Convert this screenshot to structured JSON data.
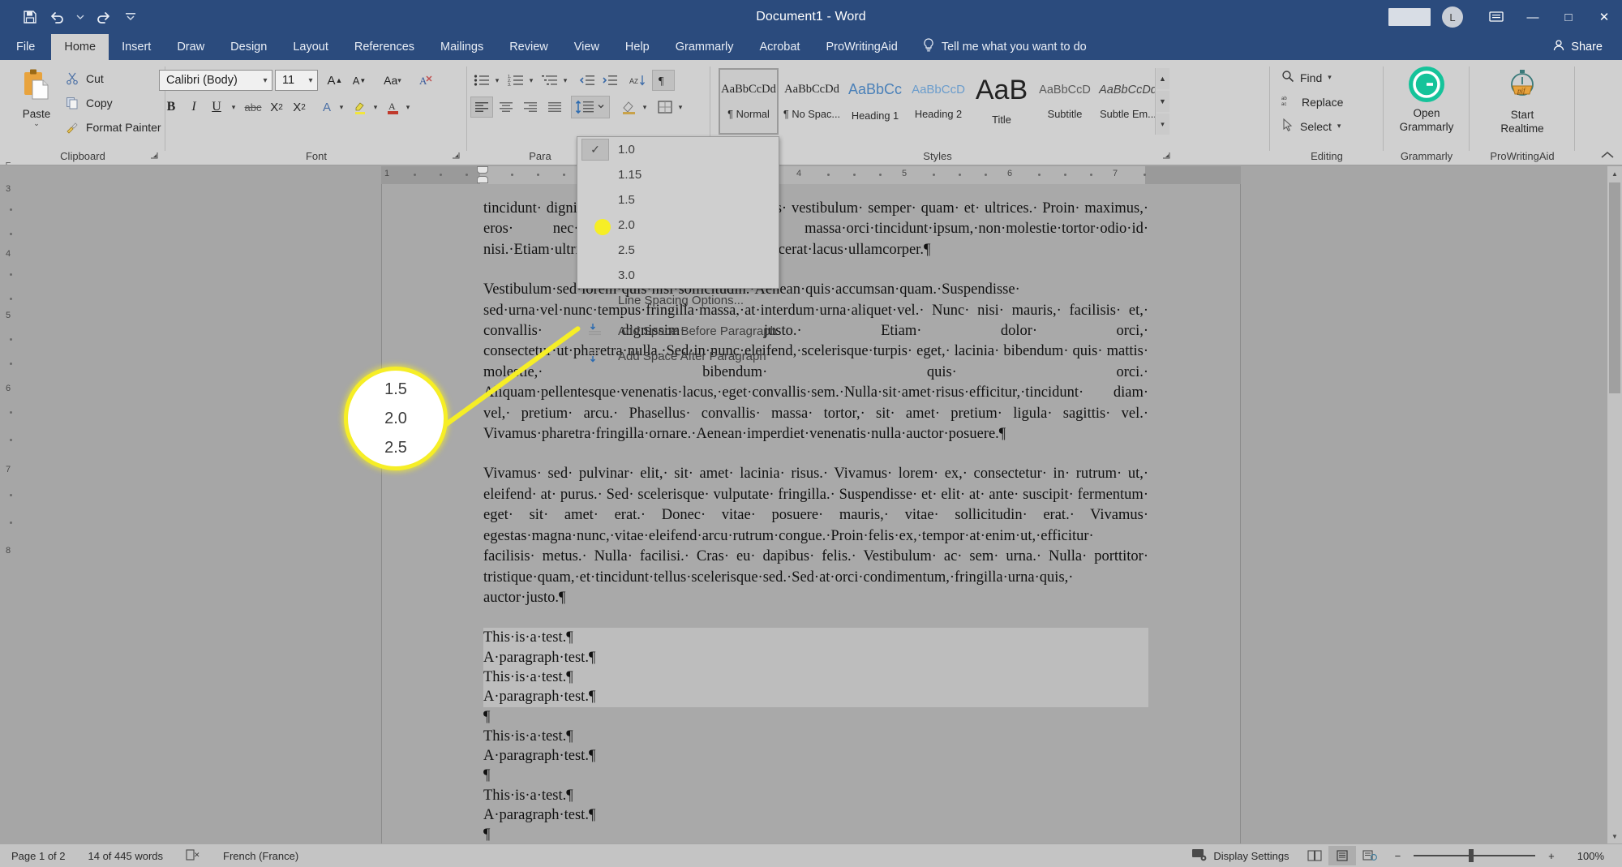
{
  "titlebar": {
    "document_title": "Document1  -  Word",
    "qat": [
      {
        "name": "save-button",
        "icon": "save-icon"
      },
      {
        "name": "undo-button",
        "icon": "undo-icon"
      },
      {
        "name": "undo-dropdown",
        "icon": "chevron-down-icon"
      },
      {
        "name": "redo-button",
        "icon": "redo-icon"
      },
      {
        "name": "customize-qat-button",
        "icon": "chevron-down-bar-icon"
      }
    ],
    "avatar_initial": "L",
    "window_controls": {
      "minimize": "—",
      "restore": "□",
      "close": "✕"
    }
  },
  "tabs": [
    {
      "label": "File",
      "active": false
    },
    {
      "label": "Home",
      "active": true
    },
    {
      "label": "Insert",
      "active": false
    },
    {
      "label": "Draw",
      "active": false
    },
    {
      "label": "Design",
      "active": false
    },
    {
      "label": "Layout",
      "active": false
    },
    {
      "label": "References",
      "active": false
    },
    {
      "label": "Mailings",
      "active": false
    },
    {
      "label": "Review",
      "active": false
    },
    {
      "label": "View",
      "active": false
    },
    {
      "label": "Help",
      "active": false
    },
    {
      "label": "Grammarly",
      "active": false
    },
    {
      "label": "Acrobat",
      "active": false
    },
    {
      "label": "ProWritingAid",
      "active": false
    }
  ],
  "tellme": {
    "label": "Tell me what you want to do"
  },
  "share": {
    "label": "Share"
  },
  "ribbon": {
    "clipboard": {
      "group_label": "Clipboard",
      "paste_label": "Paste",
      "items": [
        {
          "label": "Cut",
          "icon": "scissors-icon"
        },
        {
          "label": "Copy",
          "icon": "copy-icon"
        },
        {
          "label": "Format Painter",
          "icon": "format-painter-icon"
        }
      ]
    },
    "font": {
      "group_label": "Font",
      "font_name": "Calibri (Body)",
      "font_size": "11",
      "buttons": [
        "grow-font",
        "shrink-font",
        "change-case",
        "clear-formatting",
        "bold",
        "italic",
        "underline",
        "underline-dropdown",
        "strikethrough",
        "subscript",
        "superscript",
        "text-effects",
        "text-highlight",
        "font-color"
      ]
    },
    "paragraph": {
      "group_label": "Para",
      "buttons": [
        "bullets",
        "numbering",
        "multilevel-list",
        "decrease-indent",
        "increase-indent",
        "sort",
        "show-formatting-marks",
        "align-left",
        "align-center",
        "align-right",
        "justify",
        "line-spacing",
        "shading",
        "borders"
      ]
    },
    "styles": {
      "group_label": "Styles",
      "items": [
        {
          "preview": "AaBbCcDd",
          "name": "¶ Normal",
          "selected": true
        },
        {
          "preview": "AaBbCcDd",
          "name": "¶ No Spac...",
          "selected": false
        },
        {
          "preview": "AaBbCc",
          "name": "Heading 1",
          "selected": false
        },
        {
          "preview": "AaBbCcD",
          "name": "Heading 2",
          "selected": false
        },
        {
          "preview": "AaB",
          "name": "Title",
          "selected": false
        },
        {
          "preview": "AaBbCcD",
          "name": "Subtitle",
          "selected": false
        },
        {
          "preview": "AaBbCcDd",
          "name": "Subtle Em...",
          "selected": false
        }
      ]
    },
    "editing": {
      "group_label": "Editing",
      "items": [
        {
          "label": "Find",
          "icon": "search-icon",
          "caret": true
        },
        {
          "label": "Replace",
          "icon": "replace-icon",
          "caret": false
        },
        {
          "label": "Select",
          "icon": "cursor-arrow-icon",
          "caret": true
        }
      ]
    },
    "grammarly": {
      "group_label": "Grammarly",
      "button_label": "Open\nGrammarly",
      "line1": "Open",
      "line2": "Grammarly"
    },
    "prowritingaid": {
      "group_label": "ProWritingAid",
      "line1": "Start",
      "line2": "Realtime"
    }
  },
  "line_spacing_menu": {
    "values": [
      {
        "label": "1.0",
        "checked": true
      },
      {
        "label": "1.15",
        "checked": false
      },
      {
        "label": "1.5",
        "checked": false
      },
      {
        "label": "2.0",
        "checked": false
      },
      {
        "label": "2.5",
        "checked": false
      },
      {
        "label": "3.0",
        "checked": false
      }
    ],
    "options_label": "Line Spacing Options...",
    "add_before_label": "Add Space Before Paragraph",
    "add_after_label": "Add Space After Paragraph"
  },
  "callout": {
    "lines": [
      "1.5",
      "2.0",
      "2.5"
    ],
    "highlight_color": "#f6ee26"
  },
  "ruler": {
    "horizontal_numbers": [
      "1",
      "2",
      "3",
      "4",
      "5",
      "6",
      "7"
    ],
    "vertical_numbers": [
      "3",
      "4",
      "5",
      "6",
      "7",
      "8"
    ]
  },
  "document": {
    "paragraphs": [
      {
        "id": "p1",
        "text": "tincidunt· dignissim· sed· nec· ipsum.· Phasellus· vestibulum· semper· quam· et· ultrices.· Proin· maximus,· eros· nec· molestie· viverra,· massa·orci·tincidunt·ipsum,·non·molestie·tortor·odio·id· nisi.·Etiam·ultricies·lacus·sit·amet·risus,·nec·placerat·lacus·ullamcorper.¶"
      },
      {
        "id": "p2",
        "text": "Vestibulum·sed·lorem·quis·nisl·sollicitudin.·Aenean·quis·accumsan·quam.·Suspendisse· sed·urna·vel·nunc·tempus·fringilla·massa,·at·interdum·urna·aliquet·vel.· Nunc· nisi· mauris,· facilisis· et,· convallis· dignissim· justo.· Etiam· dolor· orci,· consectetur·ut·pharetra·nulla.·Sed·in·nunc·eleifend,·scelerisque·turpis· eget,· lacinia· bibendum· quis· mattis· molestie,· bibendum· quis· orci.· Aliquam·pellentesque·venenatis·lacus,·eget·convallis·sem.·Nulla·sit·amet·risus·efficitur,·tincidunt· diam· vel,· pretium· arcu.· Phasellus· convallis· massa· tortor,· sit· amet· pretium· ligula· sagittis· vel.· Vivamus·pharetra·fringilla·ornare.·Aenean·imperdiet·venenatis·nulla·auctor·posuere.¶"
      },
      {
        "id": "p3",
        "text": "Vivamus· sed· pulvinar· elit,· sit· amet· lacinia· risus.· Vivamus· lorem· ex,· consectetur· in· rutrum· ut,· eleifend· at· purus.· Sed· scelerisque· vulputate· fringilla.· Suspendisse· et· elit· at· ante· suscipit· fermentum· eget· sit· amet· erat.· Donec· vitae· posuere· mauris,· vitae· sollicitudin· erat.· Vivamus· egestas·magna·nunc,·vitae·eleifend·arcu·rutrum·congue.·Proin·felis·ex,·tempor·at·enim·ut,·efficitur· facilisis· metus.· Nulla· facilisi.· Cras· eu· dapibus· felis.· Vestibulum· ac· sem· urna.· Nulla· porttitor· tristique·quam,·et·tincidunt·tellus·scelerisque·sed.·Sed·at·orci·condimentum,·fringilla·urna·quis,· auctor·justo.¶"
      }
    ],
    "test_lines": [
      {
        "text": "This·is·a·test.¶",
        "highlighted": true
      },
      {
        "text": "A·paragraph·test.¶",
        "highlighted": true
      },
      {
        "text": "This·is·a·test.¶",
        "highlighted": true
      },
      {
        "text": "A·paragraph·test.¶",
        "highlighted": true
      },
      {
        "text": "¶",
        "highlighted": false
      },
      {
        "text": "This·is·a·test.¶",
        "highlighted": false
      },
      {
        "text": "A·paragraph·test.¶",
        "highlighted": false
      },
      {
        "text": "¶",
        "highlighted": false
      },
      {
        "text": "This·is·a·test.¶",
        "highlighted": false
      },
      {
        "text": "A·paragraph·test.¶",
        "highlighted": false
      },
      {
        "text": "¶",
        "highlighted": false
      }
    ]
  },
  "statusbar": {
    "page": "Page 1 of 2",
    "words": "14 of 445 words",
    "proofing_icon": "spelling-check-icon",
    "language": "French (France)",
    "display_settings": "Display Settings",
    "zoom_level": "100%",
    "views": [
      "read-mode",
      "print-layout",
      "web-layout"
    ]
  }
}
